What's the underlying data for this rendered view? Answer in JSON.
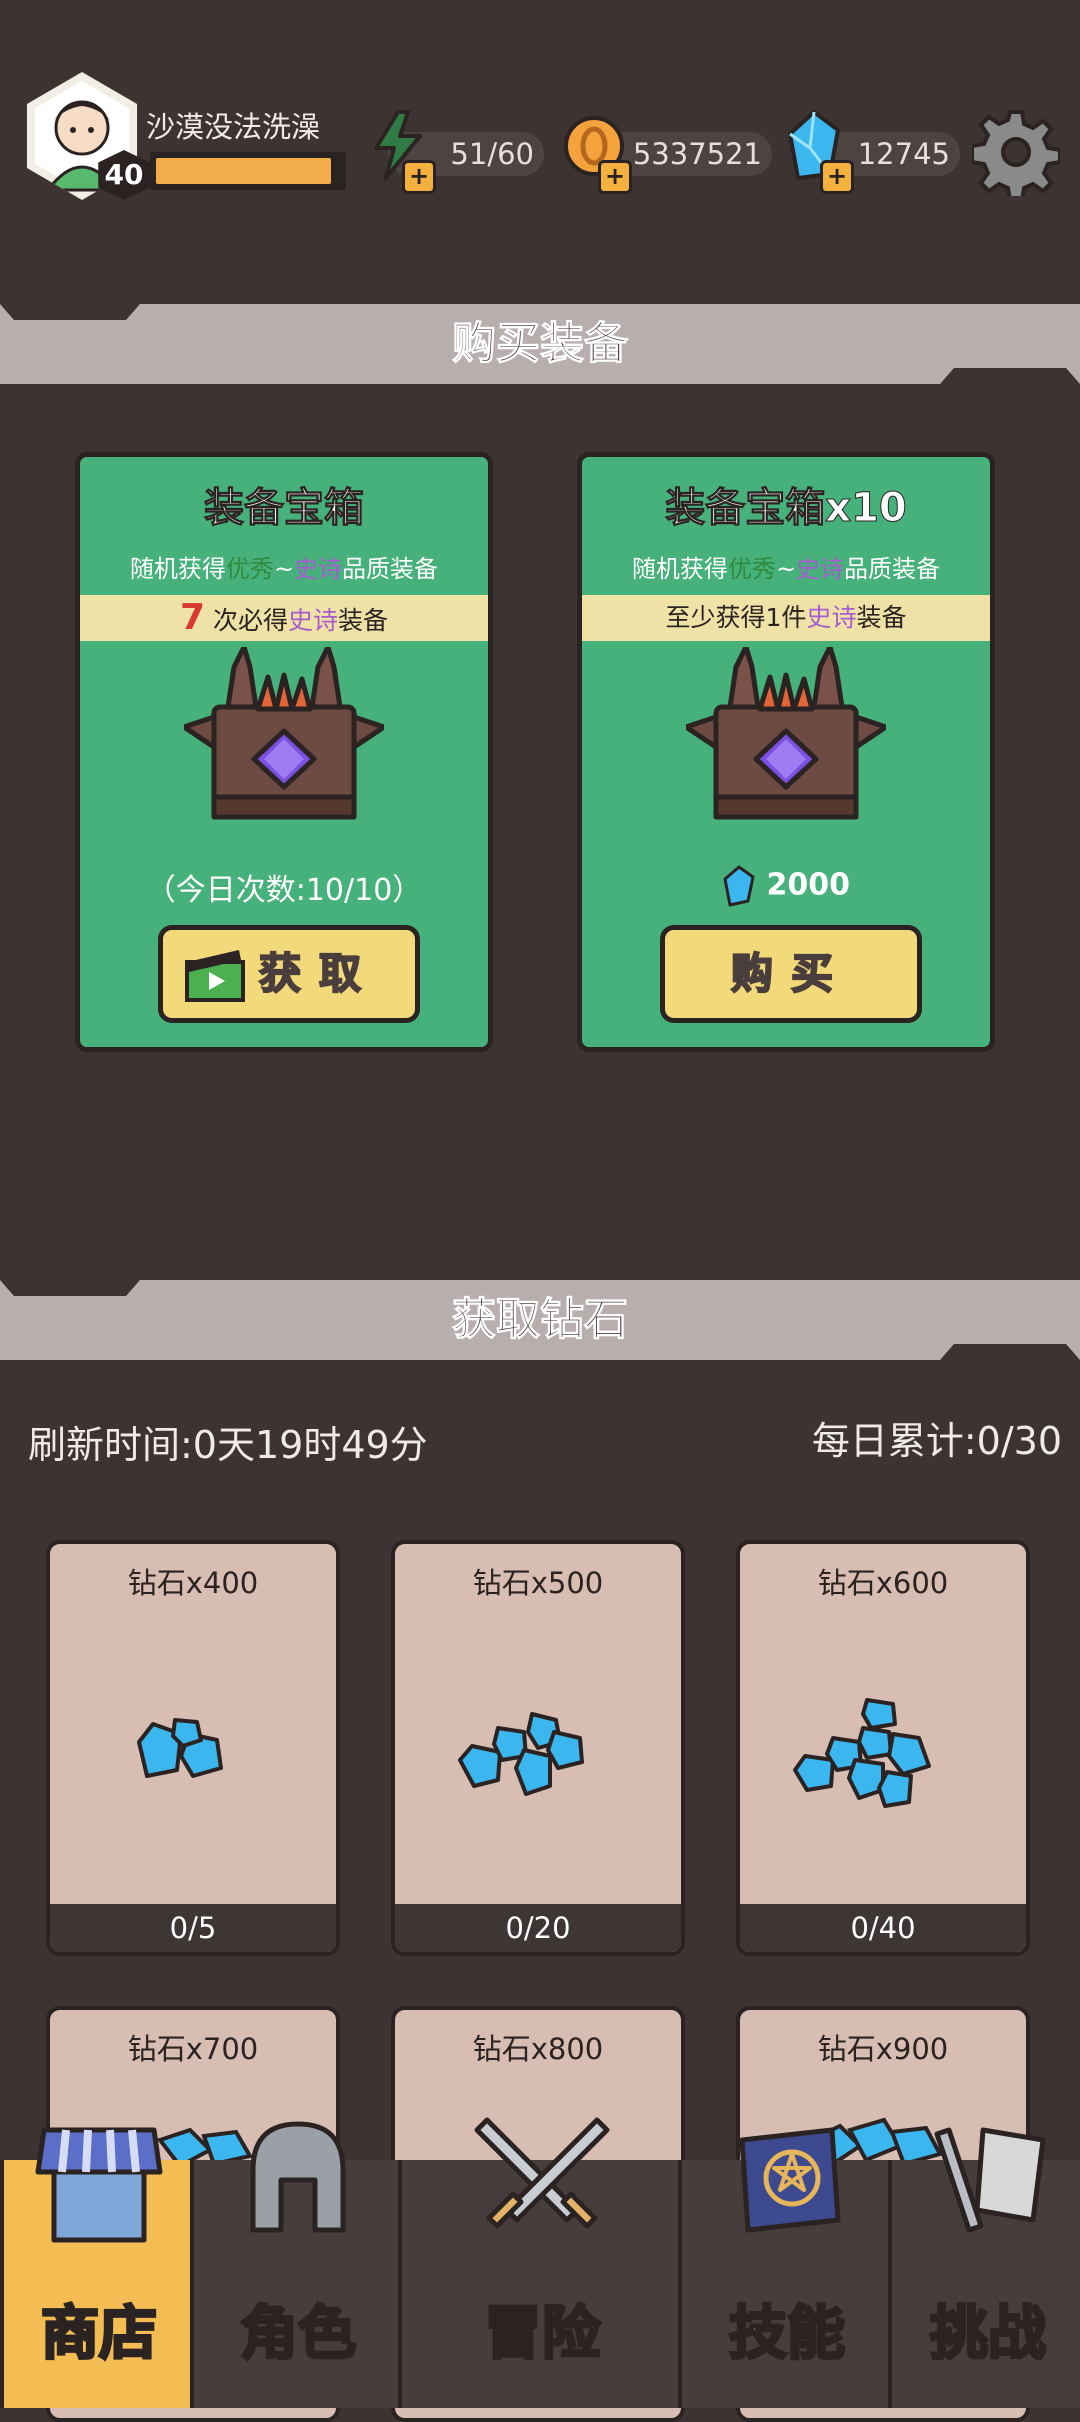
{
  "header": {
    "player_name": "沙漠没法洗澡",
    "level": "40",
    "xp_progress": 0.95,
    "stamina": "51/60",
    "coins": "5337521",
    "gems": "12745"
  },
  "equipment_section": {
    "title": "购买装备",
    "cards": [
      {
        "title": "装备宝箱",
        "desc_prefix": "随机获得",
        "desc_good": "优秀",
        "desc_tilde": "~",
        "desc_epic": "史诗",
        "desc_suffix": "品质装备",
        "strip_num": "7",
        "strip_mid": " 次必得",
        "strip_epic": "史诗",
        "strip_end": "装备",
        "sub": "（今日次数:10/10）",
        "button": "获取"
      },
      {
        "title": "装备宝箱x10",
        "desc_prefix": "随机获得",
        "desc_good": "优秀",
        "desc_tilde": "~",
        "desc_epic": "史诗",
        "desc_suffix": "品质装备",
        "strip_pre": "至少获得1件",
        "strip_epic": "史诗",
        "strip_end": "装备",
        "price": "2000",
        "button": "购买"
      }
    ]
  },
  "diamond_section": {
    "title": "获取钻石",
    "refresh": "刷新时间:0天19时49分",
    "daily": "每日累计:0/30",
    "cards": [
      {
        "title": "钻石x400",
        "count": "0/5"
      },
      {
        "title": "钻石x500",
        "count": "0/20"
      },
      {
        "title": "钻石x600",
        "count": "0/40"
      },
      {
        "title": "钻石x700",
        "count": ""
      },
      {
        "title": "钻石x800",
        "count": ""
      },
      {
        "title": "钻石x900",
        "count": ""
      }
    ]
  },
  "nav": {
    "tabs": [
      "商店",
      "角色",
      "冒险",
      "技能",
      "挑战"
    ],
    "active": 0
  },
  "colors": {
    "background": "#3c3332",
    "card_green": "#47b17c",
    "accent_gold": "#f2ad4a",
    "gem_blue": "#3bb6ee"
  }
}
